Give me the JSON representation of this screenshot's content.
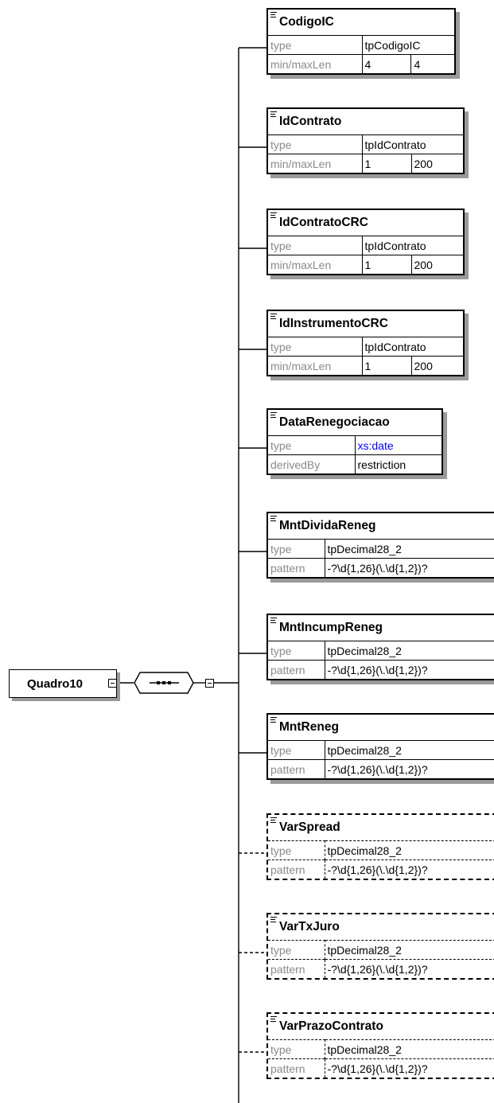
{
  "root": {
    "label": "Quadro10"
  },
  "elements": [
    {
      "name": "CodigoIC",
      "optional": false,
      "rows": [
        {
          "key": "type",
          "values": [
            "tpCodigoIC"
          ]
        },
        {
          "key": "min/maxLen",
          "values": [
            "4",
            "4"
          ]
        }
      ]
    },
    {
      "name": "IdContrato",
      "optional": false,
      "rows": [
        {
          "key": "type",
          "values": [
            "tpIdContrato"
          ]
        },
        {
          "key": "min/maxLen",
          "values": [
            "1",
            "200"
          ]
        }
      ]
    },
    {
      "name": "IdContratoCRC",
      "optional": false,
      "rows": [
        {
          "key": "type",
          "values": [
            "tpIdContrato"
          ]
        },
        {
          "key": "min/maxLen",
          "values": [
            "1",
            "200"
          ]
        }
      ]
    },
    {
      "name": "IdInstrumentoCRC",
      "optional": false,
      "rows": [
        {
          "key": "type",
          "values": [
            "tpIdContrato"
          ]
        },
        {
          "key": "min/maxLen",
          "values": [
            "1",
            "200"
          ]
        }
      ]
    },
    {
      "name": "DataRenegociacao",
      "optional": false,
      "rows": [
        {
          "key": "type",
          "values": [
            "xs:date"
          ],
          "highlight": true
        },
        {
          "key": "derivedBy",
          "values": [
            "restriction"
          ]
        }
      ]
    },
    {
      "name": "MntDividaReneg",
      "optional": false,
      "rows": [
        {
          "key": "type",
          "values": [
            "tpDecimal28_2"
          ]
        },
        {
          "key": "pattern",
          "values": [
            "-?\\d{1,26}(\\.\\d{1,2})?"
          ]
        }
      ]
    },
    {
      "name": "MntIncumpReneg",
      "optional": false,
      "rows": [
        {
          "key": "type",
          "values": [
            "tpDecimal28_2"
          ]
        },
        {
          "key": "pattern",
          "values": [
            "-?\\d{1,26}(\\.\\d{1,2})?"
          ]
        }
      ]
    },
    {
      "name": "MntReneg",
      "optional": false,
      "rows": [
        {
          "key": "type",
          "values": [
            "tpDecimal28_2"
          ]
        },
        {
          "key": "pattern",
          "values": [
            "-?\\d{1,26}(\\.\\d{1,2})?"
          ]
        }
      ]
    },
    {
      "name": "VarSpread",
      "optional": true,
      "rows": [
        {
          "key": "type",
          "values": [
            "tpDecimal28_2"
          ]
        },
        {
          "key": "pattern",
          "values": [
            "-?\\d{1,26}(\\.\\d{1,2})?"
          ]
        }
      ]
    },
    {
      "name": "VarTxJuro",
      "optional": true,
      "rows": [
        {
          "key": "type",
          "values": [
            "tpDecimal28_2"
          ]
        },
        {
          "key": "pattern",
          "values": [
            "-?\\d{1,26}(\\.\\d{1,2})?"
          ]
        }
      ]
    },
    {
      "name": "VarPrazoContrato",
      "optional": true,
      "rows": [
        {
          "key": "type",
          "values": [
            "tpDecimal28_2"
          ]
        },
        {
          "key": "pattern",
          "values": [
            "-?\\d{1,26}(\\.\\d{1,2})?"
          ]
        }
      ]
    }
  ],
  "colors": {
    "line": "#000000",
    "shadow": "#9a9a9a",
    "key_text": "#8a8a8a",
    "builtin_type": "#0000ff"
  }
}
